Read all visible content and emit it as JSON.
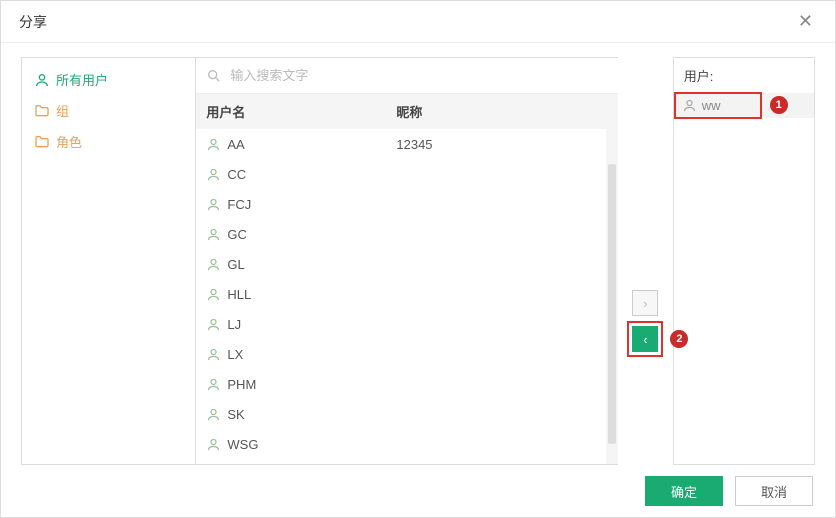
{
  "title": "分享",
  "nav": {
    "items": [
      {
        "label": "所有用户",
        "type": "user"
      },
      {
        "label": "组",
        "type": "folder"
      },
      {
        "label": "角色",
        "type": "folder"
      }
    ]
  },
  "search": {
    "placeholder": "输入搜索文字"
  },
  "table": {
    "headers": {
      "username": "用户名",
      "nickname": "昵称"
    },
    "rows": [
      {
        "username": "AA",
        "nickname": "12345"
      },
      {
        "username": "CC",
        "nickname": ""
      },
      {
        "username": "FCJ",
        "nickname": ""
      },
      {
        "username": "GC",
        "nickname": ""
      },
      {
        "username": "GL",
        "nickname": ""
      },
      {
        "username": "HLL",
        "nickname": ""
      },
      {
        "username": "LJ",
        "nickname": ""
      },
      {
        "username": "LX",
        "nickname": ""
      },
      {
        "username": "PHM",
        "nickname": ""
      },
      {
        "username": "SK",
        "nickname": ""
      },
      {
        "username": "WSG",
        "nickname": ""
      }
    ]
  },
  "rightPanel": {
    "header": "用户:",
    "selected": [
      {
        "label": "ww"
      }
    ]
  },
  "annotations": {
    "badge1": "1",
    "badge2": "2"
  },
  "buttons": {
    "ok": "确定",
    "cancel": "取消"
  }
}
